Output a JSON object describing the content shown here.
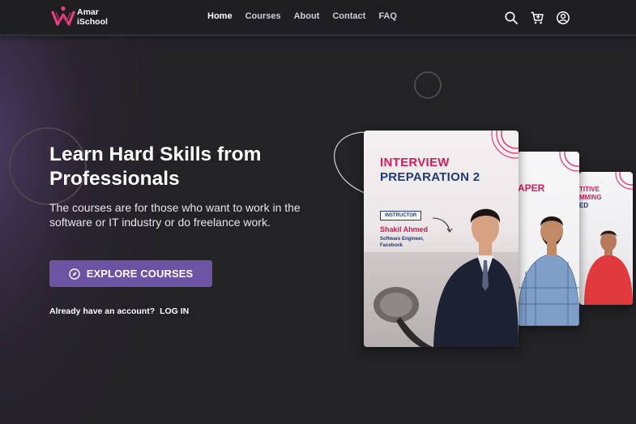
{
  "brand": {
    "name_line1": "Amar",
    "name_line2": "iSchool",
    "accent": "#6d53a3",
    "logo_color": "#e4407a"
  },
  "nav": {
    "links": [
      {
        "label": "Home",
        "active": true
      },
      {
        "label": "Courses",
        "active": false
      },
      {
        "label": "About",
        "active": false
      },
      {
        "label": "Contact",
        "active": false
      },
      {
        "label": "FAQ",
        "active": false
      }
    ],
    "icons": [
      "search-icon",
      "cart-icon",
      "user-icon"
    ]
  },
  "hero": {
    "title": "Learn Hard Skills from Professionals",
    "subtitle": "The courses are for those who want to work in the software or IT industry or do freelance work.",
    "cta_label": "EXPLORE COURSES",
    "login_prompt": "Already have an account?",
    "login_label": "LOG IN"
  },
  "courses": [
    {
      "title_line1": "INTERVIEW",
      "title_line2": "PREPARATION 2",
      "badge": "INSTRUCTOR",
      "instructor": "Shakil Ahmed",
      "role": "Software Engineer, Facebook"
    },
    {
      "title_fragment": "APER"
    },
    {
      "title_line1": "TITIVE",
      "title_line2": "MMING",
      "title_line3": "ED"
    }
  ]
}
